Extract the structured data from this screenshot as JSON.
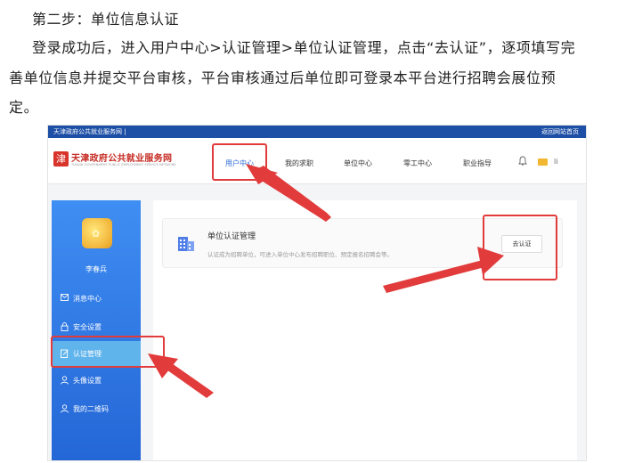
{
  "document": {
    "step_heading": "第二步：单位信息认证",
    "paragraph_lines": [
      "登录成功后，进入用户中心>认证管理>单位认证管理，点击“去认证”，逐项填写完",
      "善单位信息并提交平台审核，平台审核通过后单位即可登录本平台进行招聘会展位预",
      "定。"
    ]
  },
  "screenshot": {
    "topbar": {
      "left_text": "天津政府公共就业服务网 |",
      "right_text": "返回网站首页"
    },
    "logo": {
      "mark": "津",
      "title": "天津政府公共就业服务网",
      "subtitle": "TIANJIN GOVERNMENT PUBLIC EMPLOYMENT SERVICE NETWORK"
    },
    "nav": [
      "用户中心",
      "我的求职",
      "单位中心",
      "零工中心",
      "职业指导"
    ],
    "header_icons": {
      "bell": "bell-icon",
      "folder": "folder-icon",
      "user_initial": "li"
    },
    "sidebar": {
      "username": "李春兵",
      "items": [
        {
          "label": "消息中心",
          "icon": "mail-icon"
        },
        {
          "label": "安全设置",
          "icon": "lock-icon"
        },
        {
          "label": "认证管理",
          "icon": "edit-icon"
        },
        {
          "label": "头像设置",
          "icon": "user-icon"
        },
        {
          "label": "我的二维码",
          "icon": "user-icon"
        }
      ]
    },
    "card": {
      "title": "单位认证管理",
      "description": "认证成为招聘单位，可进入单位中心发布招聘职位、预定报名招聘会等。",
      "button": "去认证"
    },
    "colors": {
      "brand_blue": "#1d4fa6",
      "sidebar_blue": "#2f78e6",
      "highlight_red": "#e23b3b",
      "logo_red": "#c62b23"
    }
  }
}
